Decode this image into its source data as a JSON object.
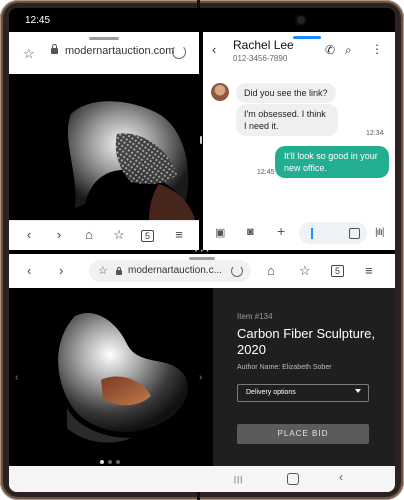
{
  "status_bar": {
    "time": "12:45"
  },
  "top_browser": {
    "url": "modernartauction.com",
    "nav": {
      "back": "‹",
      "forward": "›",
      "home": "⌂",
      "bookmark": "☆",
      "tabs": "5",
      "menu": "≡"
    }
  },
  "messages": {
    "contact_name": "Rachel Lee",
    "contact_phone": "012-3456-7890",
    "thread": [
      {
        "direction": "in",
        "text": "Did you see the link?"
      },
      {
        "direction": "in",
        "text": "I'm obsessed. I think I need it.",
        "time": "12:34"
      },
      {
        "direction": "out",
        "text": "It'll look so good in your new office.",
        "time": "12:45"
      }
    ],
    "icons": [
      "back-icon",
      "call-icon",
      "search-icon",
      "more-icon",
      "gallery-icon",
      "camera-icon",
      "add-icon",
      "sticker-icon",
      "voice-icon"
    ]
  },
  "bottom_browser": {
    "url": "modernartauction.c...",
    "product": {
      "item_number": "Item #134",
      "title": "Carbon Fiber Sculpture, 2020",
      "author": "Author Name: Elizabeth Sober",
      "delivery_select": "Delivery options",
      "bid_button": "PLACE BID"
    },
    "carousel": {
      "current": 1,
      "total": 3
    }
  },
  "colors": {
    "accent_blue": "#1a8cff",
    "sent_bubble": "#23ae92",
    "dark_panel": "#1f1f1f",
    "bid_button": "#5b5b5b"
  }
}
